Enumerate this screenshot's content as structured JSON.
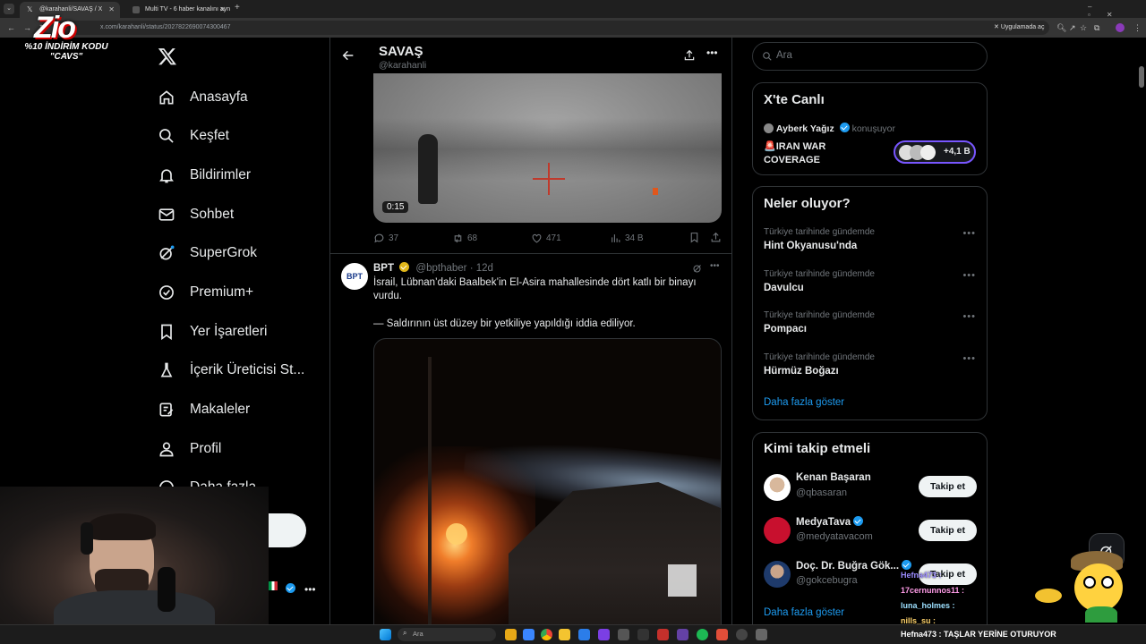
{
  "browser": {
    "tabs": [
      {
        "label": "@karahanli/SAVAŞ / X",
        "active": true
      },
      {
        "label": "Multi TV - 6 haber kanalını ayn",
        "active": false
      }
    ],
    "url": "x.com/karahanli/status/2027822690074300467",
    "app_button": "Uygulamada aç"
  },
  "stream_overlay": {
    "logo_text": "Zio",
    "promo_line1": "%10 İNDİRİM KODU",
    "promo_line2": "\"CAVS\""
  },
  "nav": {
    "items": [
      {
        "label": "Anasayfa",
        "icon": "home-icon"
      },
      {
        "label": "Keşfet",
        "icon": "search-icon"
      },
      {
        "label": "Bildirimler",
        "icon": "bell-icon"
      },
      {
        "label": "Sohbet",
        "icon": "mail-icon"
      },
      {
        "label": "SuperGrok",
        "icon": "grok-icon"
      },
      {
        "label": "Premium+",
        "icon": "verified-icon"
      },
      {
        "label": "Yer İşaretleri",
        "icon": "bookmark-icon"
      },
      {
        "label": "İçerik Üreticisi St...",
        "icon": "flask-icon"
      },
      {
        "label": "Makaleler",
        "icon": "article-icon"
      },
      {
        "label": "Profil",
        "icon": "person-icon"
      },
      {
        "label": "Daha fazla",
        "icon": "more-circle-icon"
      }
    ]
  },
  "header": {
    "title": "SAVAŞ",
    "handle": "@karahanli"
  },
  "video1": {
    "timestamp": "0:15"
  },
  "tweet1_actions": {
    "replies": "37",
    "retweets": "68",
    "likes": "471",
    "views": "34 B"
  },
  "tweet2": {
    "avatar_text": "BPT",
    "name": "BPT",
    "handle": "@bpthaber",
    "time": "· 12d",
    "text1": "İsrail, Lübnan’daki Baalbek’in El-Asira mahallesinde dört katlı bir binayı vurdu.",
    "text2": "— Saldırının üst düzey bir yetkiliye yapıldığı iddia ediliyor."
  },
  "search": {
    "placeholder": "Ara"
  },
  "live": {
    "title": "X'te Canlı",
    "host": "Ayberk Yağız",
    "status": "konuşuyor",
    "space_title_line1": "🚨IRAN WAR",
    "space_title_line2": "COVERAGE",
    "listeners": "+4,1 B"
  },
  "trends": {
    "title": "Neler oluyor?",
    "items": [
      {
        "context": "Türkiye tarihinde gündemde",
        "name": "Hint Okyanusu'nda"
      },
      {
        "context": "Türkiye tarihinde gündemde",
        "name": "Davulcu"
      },
      {
        "context": "Türkiye tarihinde gündemde",
        "name": "Pompacı"
      },
      {
        "context": "Türkiye tarihinde gündemde",
        "name": "Hürmüz Boğazı"
      }
    ],
    "show_more": "Daha fazla göster"
  },
  "who_to_follow": {
    "title": "Kimi takip etmeli",
    "items": [
      {
        "name": "Kenan Başaran",
        "handle": "@qbasaran",
        "button": "Takip et",
        "verified": false
      },
      {
        "name": "MedyaTava",
        "handle": "@medyatavacom",
        "button": "Takip et",
        "verified": true
      },
      {
        "name": "Doç. Dr. Buğra Gök...",
        "handle": "@gokcebugra",
        "button": "Takip et",
        "verified": true
      }
    ],
    "show_more": "Daha fazla göster"
  },
  "chat": {
    "lines": [
      {
        "user": "Hefna473",
        "text": "Hefna473 :"
      },
      {
        "user": "17cernunnos11",
        "text": "17cernunnos11 :"
      },
      {
        "user": "luna_holmes",
        "text": "luna_holmes :"
      },
      {
        "user": "nills_su",
        "text": "nills_su :"
      },
      {
        "user": "Hefna473",
        "text": "Hefna473 : TAŞLAR YERİNE OTURUYOR"
      }
    ]
  },
  "taskbar": {
    "search_placeholder": "Ara"
  },
  "colors": {
    "accent": "#1d9bf0",
    "background": "#000000",
    "border": "#2f3336",
    "muted": "#71767b"
  }
}
